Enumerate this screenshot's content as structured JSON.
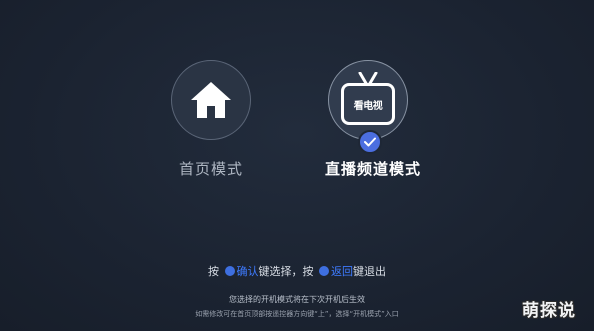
{
  "modes": {
    "home": {
      "label": "首页模式",
      "icon": "home-icon",
      "selected": false
    },
    "live": {
      "label": "直播频道模式",
      "icon": "tv-icon",
      "tv_text": "看电视",
      "selected": true
    }
  },
  "hint": {
    "prefix": "按",
    "confirm": "确认",
    "middle": "键选择，按",
    "back": "返回",
    "suffix": "键退出"
  },
  "notes": {
    "line1": "您选择的开机模式将在下次开机后生效",
    "line2": "如需修改可在首页顶部按遥控器方向键“上”，选择“开机模式”入口"
  },
  "watermark": "萌探说",
  "colors": {
    "accent": "#3e7bff",
    "check": "#4b6ee0",
    "background": "#1b2331"
  }
}
